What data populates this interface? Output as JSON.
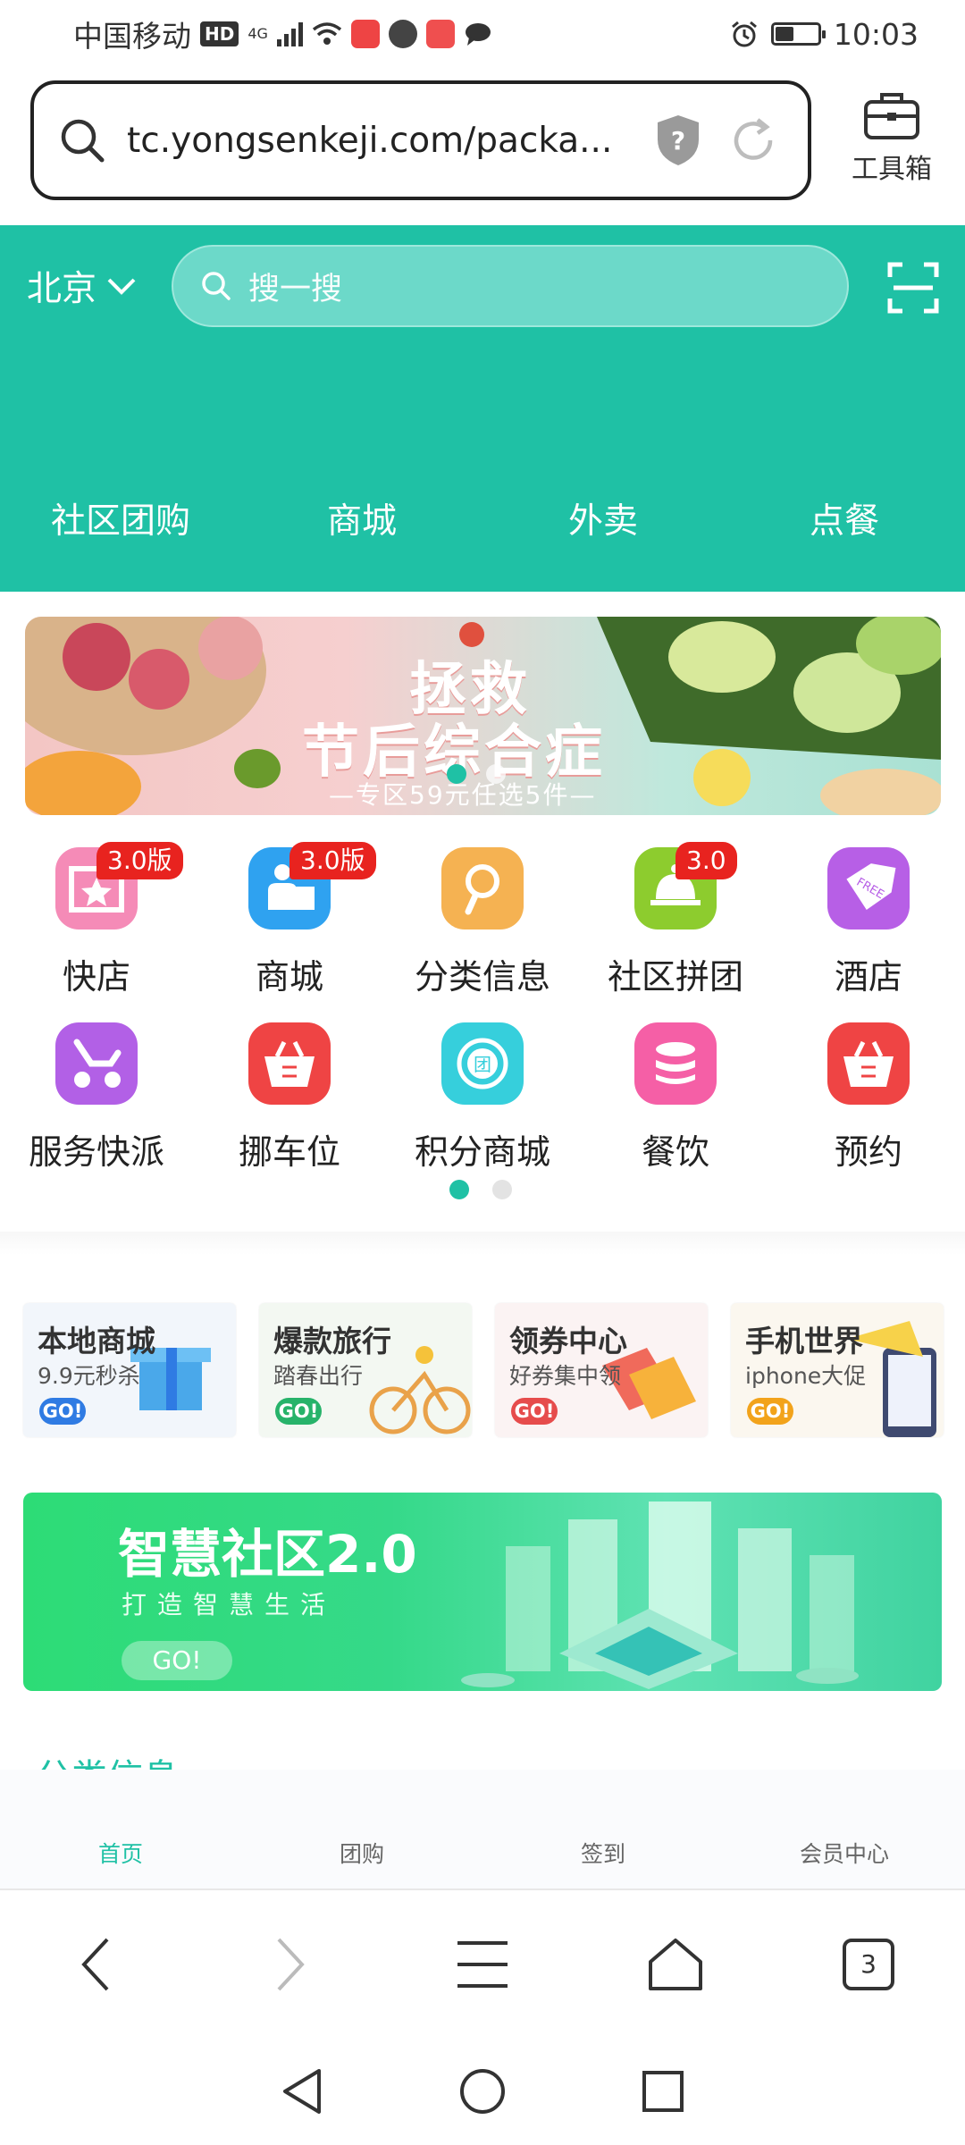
{
  "status_bar": {
    "carrier": "中国移动",
    "hd": "HD",
    "network": "4G",
    "time": "10:03"
  },
  "url_bar": {
    "url": "tc.yongsenkeji.com/packa...",
    "toolbox_label": "工具箱"
  },
  "header": {
    "city": "北京",
    "search_placeholder": "搜一搜",
    "nav": [
      "社区团购",
      "商城",
      "外卖",
      "点餐"
    ]
  },
  "banner": {
    "title_line1": "拯救",
    "title_line2": "节后综合症",
    "subtitle": "—专区59元任选5件—"
  },
  "grid": {
    "row1": [
      {
        "label": "快店",
        "badge": "3.0版",
        "color": "#f58bb7",
        "icon": "store-star-icon"
      },
      {
        "label": "商城",
        "badge": "3.0版",
        "color": "#2fa2f0",
        "icon": "cashier-icon"
      },
      {
        "label": "分类信息",
        "badge": "",
        "color": "#f5b252",
        "icon": "search-magnifier-icon"
      },
      {
        "label": "社区拼团",
        "badge": "3.0",
        "color": "#8dcc2e",
        "icon": "dish-cloche-icon"
      },
      {
        "label": "酒店",
        "badge": "",
        "color": "#b75fe6",
        "icon": "tag-free-icon"
      }
    ],
    "row2": [
      {
        "label": "服务快派",
        "badge": "",
        "color": "#b260e6",
        "icon": "scooter-icon"
      },
      {
        "label": "挪车位",
        "badge": "",
        "color": "#ef4444",
        "icon": "basket-icon"
      },
      {
        "label": "积分商城",
        "badge": "",
        "color": "#36cfdc",
        "icon": "group-coin-icon"
      },
      {
        "label": "餐饮",
        "badge": "",
        "color": "#f55fa6",
        "icon": "stack-icon"
      },
      {
        "label": "预约",
        "badge": "",
        "color": "#ef4444",
        "icon": "basket-icon"
      }
    ]
  },
  "promo_cards": [
    {
      "title": "本地商城",
      "subtitle": "9.9元秒杀",
      "go": "GO!",
      "go_color": "#2f7be3",
      "bg": "#f2f6fb"
    },
    {
      "title": "爆款旅行",
      "subtitle": "踏春出行",
      "go": "GO!",
      "go_color": "#27b36a",
      "bg": "#f3f8f2"
    },
    {
      "title": "领券中心",
      "subtitle": "好券集中领",
      "go": "GO!",
      "go_color": "#e64c4c",
      "bg": "#fbf3f3"
    },
    {
      "title": "手机世界",
      "subtitle": "iphone大促",
      "go": "GO!",
      "go_color": "#f2a31b",
      "bg": "#fbf7ef"
    }
  ],
  "smart_banner": {
    "title": "智慧社区2.0",
    "subtitle": "打造智慧生活",
    "go": "GO!"
  },
  "tabbar": {
    "partial_heading": "分类信息",
    "tabs": [
      "首页",
      "团购",
      "签到",
      "会员中心"
    ],
    "active": 0
  },
  "browser_nav": {
    "tab_count": "3"
  },
  "colors": {
    "accent": "#1fc1a5",
    "badge": "#e8231f"
  }
}
